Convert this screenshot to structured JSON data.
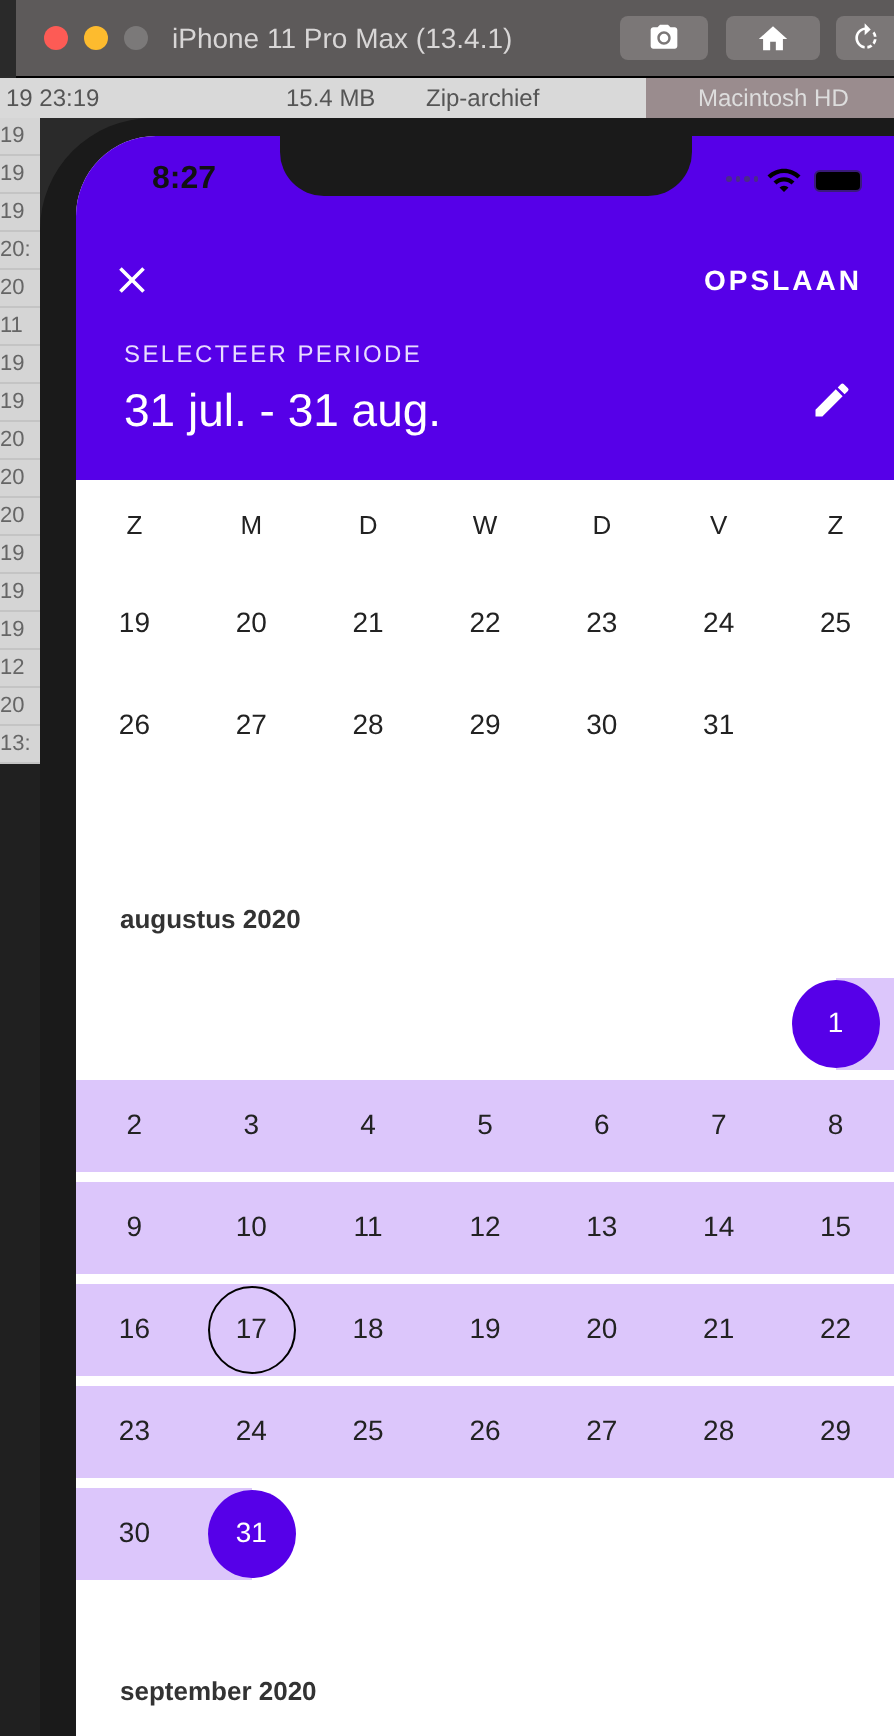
{
  "simulator": {
    "title": "iPhone 11 Pro Max (13.4.1)"
  },
  "background": {
    "top_row": [
      "19 23:19",
      "15.4 MB",
      "Zip-archief",
      "Macintosh HD"
    ],
    "left_column": [
      "19",
      "19",
      "19",
      "20:",
      "20",
      "11",
      "19",
      "19",
      "20",
      "20",
      "20",
      "19",
      "19",
      "19",
      "12",
      "20",
      "13:"
    ]
  },
  "status_bar": {
    "time": "8:27"
  },
  "header": {
    "save": "OPSLAAN",
    "label": "SELECTEER PERIODE",
    "range": "31 jul. - 31 aug."
  },
  "weekdays": [
    "Z",
    "M",
    "D",
    "W",
    "D",
    "V",
    "Z"
  ],
  "months": [
    {
      "weeks": [
        [
          {
            "kind": "day",
            "day": "19",
            "in_range": false,
            "selected": false,
            "today": false
          },
          {
            "kind": "day",
            "day": "20",
            "in_range": false,
            "selected": false,
            "today": false
          },
          {
            "kind": "day",
            "day": "21",
            "in_range": false,
            "selected": false,
            "today": false
          },
          {
            "kind": "day",
            "day": "22",
            "in_range": false,
            "selected": false,
            "today": false
          },
          {
            "kind": "day",
            "day": "23",
            "in_range": false,
            "selected": false,
            "today": false
          },
          {
            "kind": "day",
            "day": "24",
            "in_range": false,
            "selected": false,
            "today": false
          },
          {
            "kind": "day",
            "day": "25",
            "in_range": false,
            "selected": false,
            "today": false
          }
        ],
        [
          {
            "kind": "day",
            "day": "26",
            "in_range": false,
            "selected": false,
            "today": false
          },
          {
            "kind": "day",
            "day": "27",
            "in_range": false,
            "selected": false,
            "today": false
          },
          {
            "kind": "day",
            "day": "28",
            "in_range": false,
            "selected": false,
            "today": false
          },
          {
            "kind": "day",
            "day": "29",
            "in_range": false,
            "selected": false,
            "today": false
          },
          {
            "kind": "day",
            "day": "30",
            "in_range": false,
            "selected": false,
            "today": false
          },
          {
            "kind": "day",
            "day": "31",
            "in_range": false,
            "selected": false,
            "today": false
          },
          {
            "kind": "blank"
          }
        ]
      ]
    },
    {
      "title": "augustus 2020",
      "weeks": [
        [
          {
            "kind": "blank"
          },
          {
            "kind": "blank"
          },
          {
            "kind": "blank"
          },
          {
            "kind": "blank"
          },
          {
            "kind": "blank"
          },
          {
            "kind": "blank"
          },
          {
            "kind": "day",
            "day": "1",
            "in_range": true,
            "selected": true,
            "today": false
          }
        ],
        [
          {
            "kind": "day",
            "day": "2",
            "in_range": true,
            "selected": false,
            "today": false
          },
          {
            "kind": "day",
            "day": "3",
            "in_range": true,
            "selected": false,
            "today": false
          },
          {
            "kind": "day",
            "day": "4",
            "in_range": true,
            "selected": false,
            "today": false
          },
          {
            "kind": "day",
            "day": "5",
            "in_range": true,
            "selected": false,
            "today": false
          },
          {
            "kind": "day",
            "day": "6",
            "in_range": true,
            "selected": false,
            "today": false
          },
          {
            "kind": "day",
            "day": "7",
            "in_range": true,
            "selected": false,
            "today": false
          },
          {
            "kind": "day",
            "day": "8",
            "in_range": true,
            "selected": false,
            "today": false
          }
        ],
        [
          {
            "kind": "day",
            "day": "9",
            "in_range": true,
            "selected": false,
            "today": false
          },
          {
            "kind": "day",
            "day": "10",
            "in_range": true,
            "selected": false,
            "today": false
          },
          {
            "kind": "day",
            "day": "11",
            "in_range": true,
            "selected": false,
            "today": false
          },
          {
            "kind": "day",
            "day": "12",
            "in_range": true,
            "selected": false,
            "today": false
          },
          {
            "kind": "day",
            "day": "13",
            "in_range": true,
            "selected": false,
            "today": false
          },
          {
            "kind": "day",
            "day": "14",
            "in_range": true,
            "selected": false,
            "today": false
          },
          {
            "kind": "day",
            "day": "15",
            "in_range": true,
            "selected": false,
            "today": false
          }
        ],
        [
          {
            "kind": "day",
            "day": "16",
            "in_range": true,
            "selected": false,
            "today": false
          },
          {
            "kind": "day",
            "day": "17",
            "in_range": true,
            "selected": false,
            "today": true
          },
          {
            "kind": "day",
            "day": "18",
            "in_range": true,
            "selected": false,
            "today": false
          },
          {
            "kind": "day",
            "day": "19",
            "in_range": true,
            "selected": false,
            "today": false
          },
          {
            "kind": "day",
            "day": "20",
            "in_range": true,
            "selected": false,
            "today": false
          },
          {
            "kind": "day",
            "day": "21",
            "in_range": true,
            "selected": false,
            "today": false
          },
          {
            "kind": "day",
            "day": "22",
            "in_range": true,
            "selected": false,
            "today": false
          }
        ],
        [
          {
            "kind": "day",
            "day": "23",
            "in_range": true,
            "selected": false,
            "today": false
          },
          {
            "kind": "day",
            "day": "24",
            "in_range": true,
            "selected": false,
            "today": false
          },
          {
            "kind": "day",
            "day": "25",
            "in_range": true,
            "selected": false,
            "today": false
          },
          {
            "kind": "day",
            "day": "26",
            "in_range": true,
            "selected": false,
            "today": false
          },
          {
            "kind": "day",
            "day": "27",
            "in_range": true,
            "selected": false,
            "today": false
          },
          {
            "kind": "day",
            "day": "28",
            "in_range": true,
            "selected": false,
            "today": false
          },
          {
            "kind": "day",
            "day": "29",
            "in_range": true,
            "selected": false,
            "today": false
          }
        ],
        [
          {
            "kind": "day",
            "day": "30",
            "in_range": true,
            "selected": false,
            "today": false
          },
          {
            "kind": "day",
            "day": "31",
            "in_range": true,
            "selected": true,
            "today": false
          },
          {
            "kind": "blank"
          },
          {
            "kind": "blank"
          },
          {
            "kind": "blank"
          },
          {
            "kind": "blank"
          },
          {
            "kind": "blank"
          }
        ]
      ]
    },
    {
      "title": "september 2020"
    }
  ]
}
